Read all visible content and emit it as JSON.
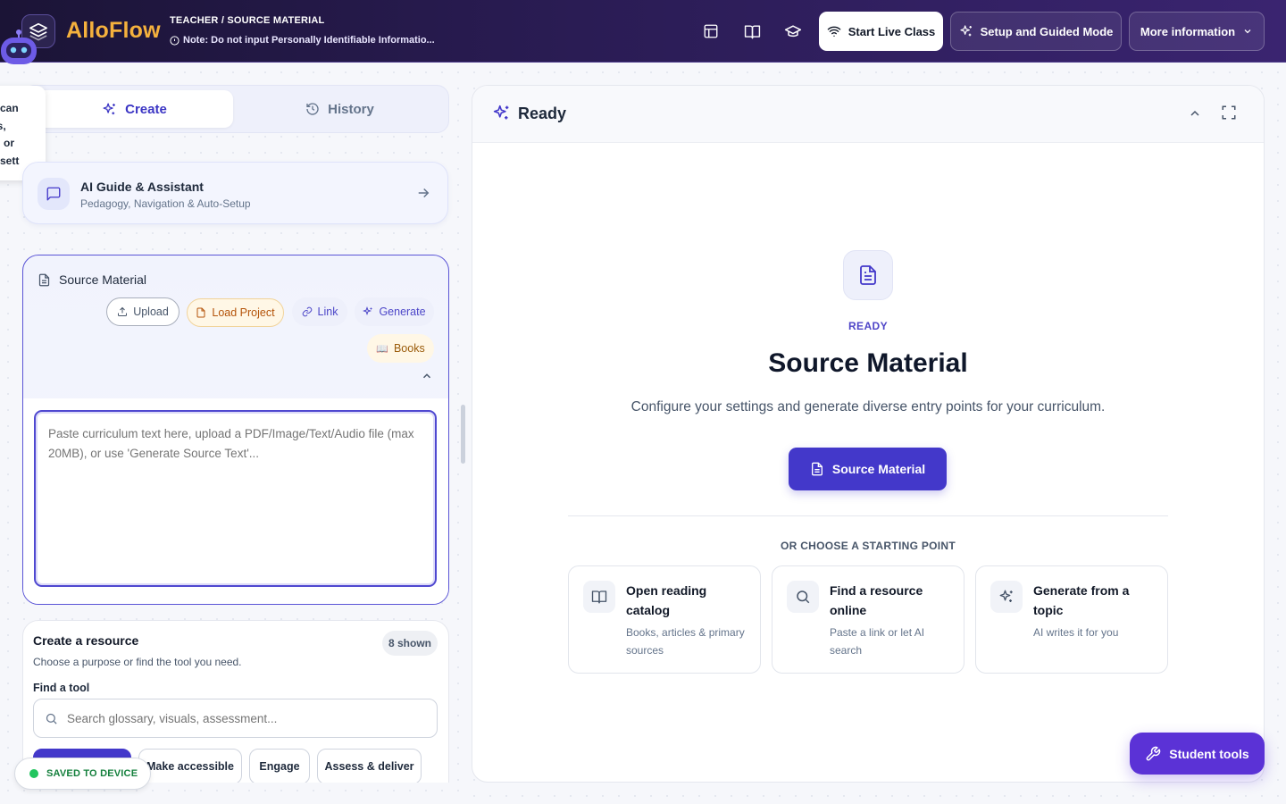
{
  "app": {
    "brand": "AlloFlow",
    "role_path": "TEACHER / SOURCE MATERIAL",
    "note": "Note: Do not input Personally Identifiable Informatio..."
  },
  "topbar": {
    "icons": [
      "layout-icon",
      "book-open-icon",
      "graduation-cap-icon"
    ],
    "start_live": "Start Live Class",
    "setup": "Setup and Guided Mode",
    "more": "More information"
  },
  "mascot_bubble": [
    "can",
    "es,",
    "u, or",
    "sett"
  ],
  "left": {
    "tabs": {
      "create": "Create",
      "history": "History"
    },
    "guide": {
      "title": "AI Guide & Assistant",
      "subtitle": "Pedagogy, Navigation & Auto-Setup"
    },
    "source": {
      "title": "Source Material",
      "chips": {
        "upload": "Upload",
        "load": "Load Project",
        "link": "Link",
        "generate": "Generate",
        "books": "Books"
      },
      "placeholder": "Paste curriculum text here, upload a PDF/Image/Text/Audio file (max 20MB), or use 'Generate Source Text'..."
    },
    "resource": {
      "title": "Create a resource",
      "subtitle": "Choose a purpose or find the tool you need.",
      "badge": "8 shown",
      "find_label": "Find a tool",
      "search_placeholder": "Search glossary, visuals, assessment...",
      "filters": [
        "Make accessible",
        "Engage",
        "Assess & deliver"
      ]
    },
    "saved": "SAVED TO DEVICE"
  },
  "main": {
    "header": "Ready",
    "kicker": "READY",
    "title": "Source Material",
    "lead": "Configure your settings and generate diverse entry points for your curriculum.",
    "cta": "Source Material",
    "or_label": "OR CHOOSE A STARTING POINT",
    "starting_points": [
      {
        "title": "Open reading catalog",
        "subtitle": "Books, articles & primary sources",
        "icon": "book-open-icon"
      },
      {
        "title": "Find a resource online",
        "subtitle": "Paste a link or let AI search",
        "icon": "search-icon"
      },
      {
        "title": "Generate from a topic",
        "subtitle": "AI writes it for you",
        "icon": "sparkles-icon"
      }
    ]
  },
  "student_tools": "Student tools",
  "colors": {
    "accent": "#4338ca",
    "brand": "#f5b13d",
    "topbar": "#2a1c54",
    "student": "#5b32d6",
    "saved": "#15803d"
  }
}
